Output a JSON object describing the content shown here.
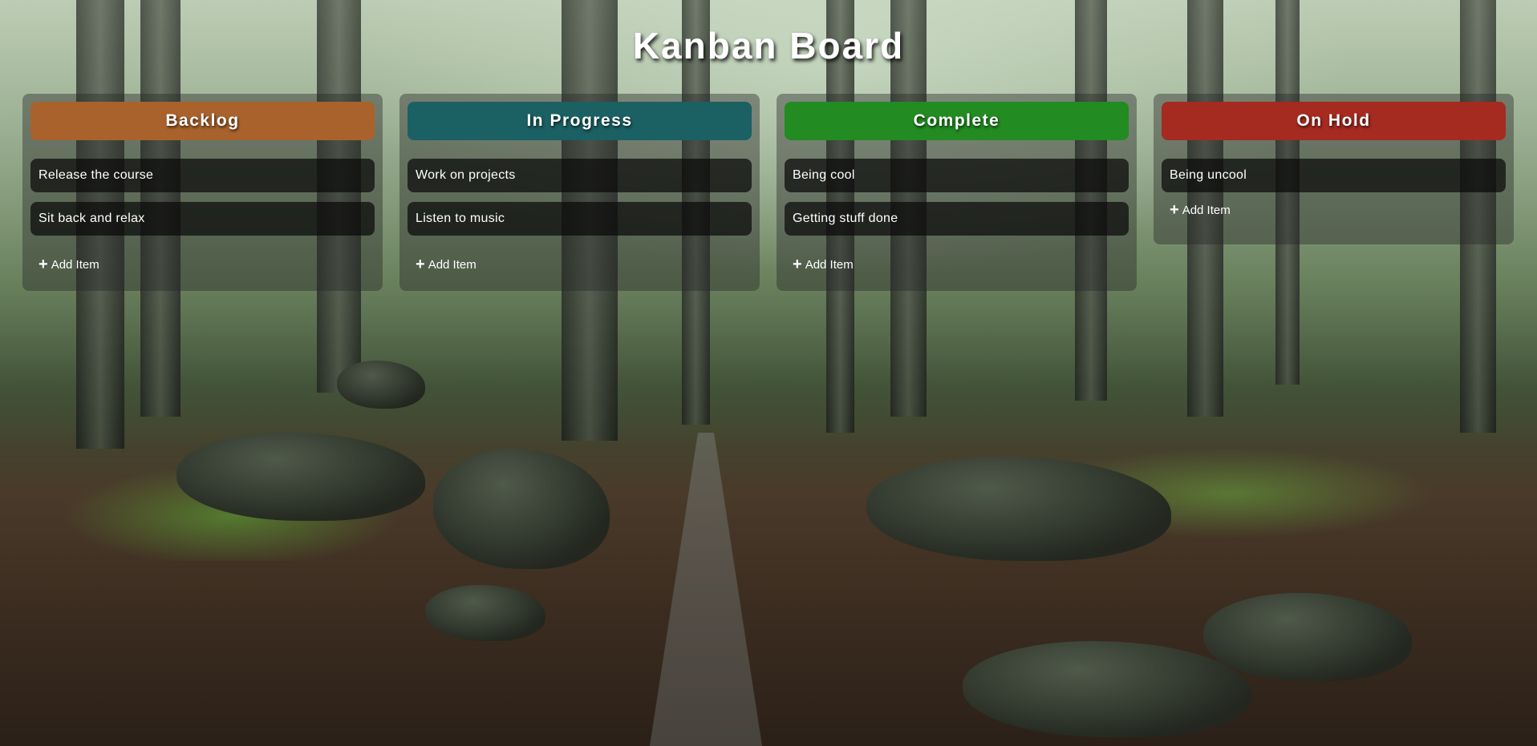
{
  "page": {
    "title": "Kanban Board"
  },
  "colors": {
    "backlog": "#a9622c",
    "in_progress": "#1b6063",
    "complete": "#228b22",
    "on_hold": "#a52a20"
  },
  "columns": [
    {
      "key": "backlog",
      "title": "Backlog",
      "items": [
        "Release the course",
        "Sit back and relax"
      ],
      "add_label": "Add Item",
      "add_icon": "plus-icon"
    },
    {
      "key": "in_progress",
      "title": "In Progress",
      "items": [
        "Work on projects",
        "Listen to music"
      ],
      "add_label": "Add Item",
      "add_icon": "plus-icon"
    },
    {
      "key": "complete",
      "title": "Complete",
      "items": [
        "Being cool",
        "Getting stuff done"
      ],
      "add_label": "Add Item",
      "add_icon": "plus-icon"
    },
    {
      "key": "on_hold",
      "title": "On Hold",
      "items": [
        "Being uncool"
      ],
      "add_label": "Add Item",
      "add_icon": "plus-icon"
    }
  ]
}
